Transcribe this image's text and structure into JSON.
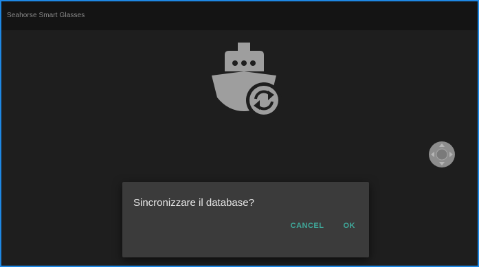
{
  "app": {
    "title": "Seahorse Smart Glasses"
  },
  "dialog": {
    "message": "Sincronizzare il database?",
    "cancel_label": "CANCEL",
    "ok_label": "OK"
  },
  "icons": {
    "center": "ship-sync-icon",
    "right": "dpad-navigation-icon"
  },
  "colors": {
    "background": "#1e1e1e",
    "app_bar": "#141414",
    "frame_border": "#1e88e5",
    "dialog_background": "#3b3b3b",
    "accent": "#3fa89a",
    "icon": "#9e9e9e"
  }
}
